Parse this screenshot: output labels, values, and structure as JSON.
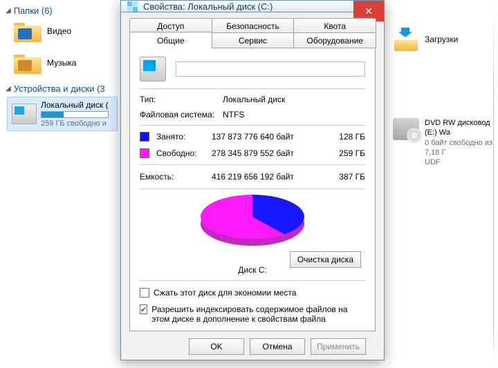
{
  "explorer": {
    "folders_header": "Папки (6)",
    "items": [
      {
        "label": "Видео",
        "inner_color": "#2a6eb8"
      },
      {
        "label": "Музыка",
        "inner_color": "#d08a2c"
      }
    ],
    "devices_header": "Устройства и диски (3",
    "drive": {
      "name": "Локальный диск (",
      "free_line": "259 ГБ свободно и"
    },
    "downloads_label": "Загрузки",
    "dvd": {
      "name": "DVD RW дисковод (E:) Wa",
      "sub1": "0 байт свободно из 7,18 Г",
      "sub2": "UDF"
    }
  },
  "dialog": {
    "title": "Свойства: Локальный диск (C:)",
    "close": "✕",
    "tabs_top": [
      "Доступ",
      "Безопасность",
      "Квота"
    ],
    "tabs_bottom": [
      "Общие",
      "Сервис",
      "Оборудование"
    ],
    "active_tab": "Общие",
    "name_value": "",
    "type_label": "Тип:",
    "type_value": "Локальный диск",
    "fs_label": "Файловая система:",
    "fs_value": "NTFS",
    "used_label": "Занято:",
    "used_bytes": "137 873 776 640 байт",
    "used_gb": "128 ГБ",
    "free_label": "Свободно:",
    "free_bytes": "278 345 879 552 байт",
    "free_gb": "259 ГБ",
    "cap_label": "Емкость:",
    "cap_bytes": "416 219 656 192 байт",
    "cap_gb": "387 ГБ",
    "disk_name": "Диск C:",
    "cleanup_btn": "Очистка диска",
    "compress_label": "Сжать этот диск для экономии места",
    "index_label": "Разрешить индексировать содержимое файлов на этом диске в дополнение к свойствам файла",
    "compress_checked": false,
    "index_checked": true,
    "buttons": {
      "ok": "OK",
      "cancel": "Отмена",
      "apply": "Применить"
    }
  },
  "chart_data": {
    "type": "pie",
    "title": "Диск C:",
    "series": [
      {
        "name": "Занято",
        "value_bytes": 137873776640,
        "value_gb": 128,
        "color": "#1717ff"
      },
      {
        "name": "Свободно",
        "value_bytes": 278345879552,
        "value_gb": 259,
        "color": "#ff1afc"
      }
    ],
    "total_bytes": 416219656192,
    "total_gb": 387
  }
}
